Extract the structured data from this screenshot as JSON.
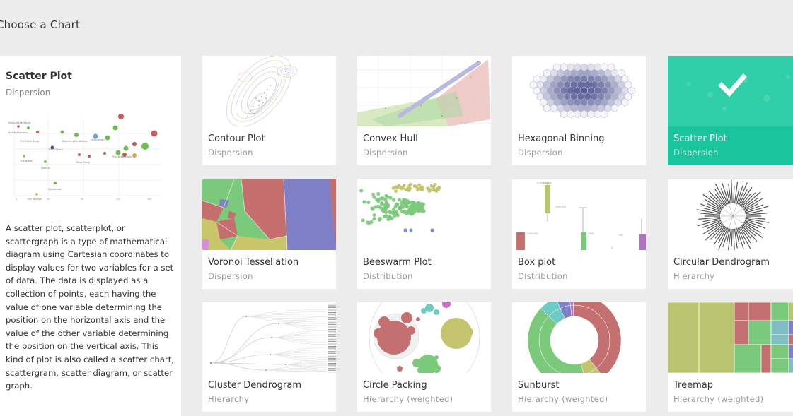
{
  "page": {
    "title": "Choose a Chart"
  },
  "detail": {
    "title": "Scatter Plot",
    "category": "Dispersion",
    "description": "A scatter plot, scatterplot, or scattergraph is a type of mathematical diagram using Cartesian coordinates to display values for two variables for a set of data. The data is displayed as a collection of points, each having the value of one variable determining the position on the horizontal axis and the value of the other variable determining the position on the vertical axis. This kind of plot is also called a scatter chart, scattergram, scatter diagram, or scatter graph."
  },
  "charts": [
    {
      "title": "Contour Plot",
      "category": "Dispersion"
    },
    {
      "title": "Convex Hull",
      "category": "Dispersion"
    },
    {
      "title": "Hexagonal Binning",
      "category": "Dispersion"
    },
    {
      "title": "Scatter Plot",
      "category": "Dispersion",
      "selected": true
    },
    {
      "title": "Voronoi Tessellation",
      "category": "Dispersion"
    },
    {
      "title": "Beeswarm Plot",
      "category": "Distribution"
    },
    {
      "title": "Box plot",
      "category": "Distribution"
    },
    {
      "title": "Circular Dendrogram",
      "category": "Hierarchy"
    },
    {
      "title": "Cluster Dendrogram",
      "category": "Hierarchy"
    },
    {
      "title": "Circle Packing",
      "category": "Hierarchy (weighted)"
    },
    {
      "title": "Sunburst",
      "category": "Hierarchy (weighted)"
    },
    {
      "title": "Treemap",
      "category": "Hierarchy (weighted)"
    }
  ],
  "colors": {
    "accent": "#1ac59e",
    "background": "#ececec"
  }
}
